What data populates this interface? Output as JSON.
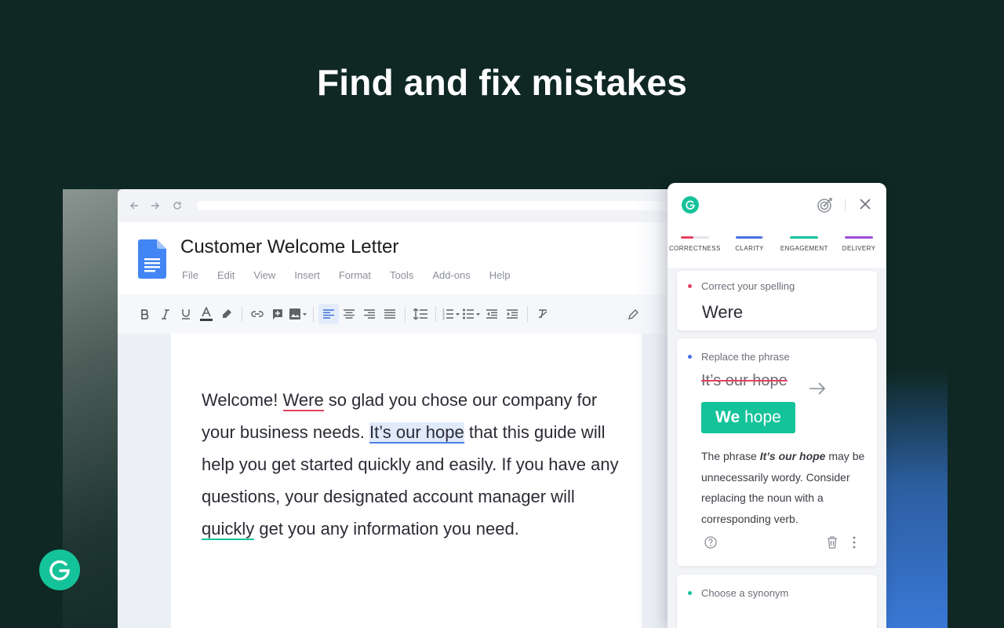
{
  "headline": "Find and fix mistakes",
  "document": {
    "title": "Customer Welcome Letter",
    "menu": [
      "File",
      "Edit",
      "View",
      "Insert",
      "Format",
      "Tools",
      "Add-ons",
      "Help"
    ],
    "text": {
      "p1": "Welcome! ",
      "flag_spelling": "Were",
      "p2": " so glad you chose our company for your business needs. ",
      "flag_phrase": "It’s our hope",
      "p3": " that this guide will help you get started quickly and easily. If you have any questions, your designated account manager will ",
      "flag_synonym": "quickly",
      "p4": " get you any information you need."
    },
    "toolbar_icons": [
      "bold-icon",
      "italic-icon",
      "underline-icon",
      "text-color-icon",
      "highlight-icon",
      "link-icon",
      "comment-icon",
      "image-icon",
      "align-left-icon",
      "align-center-icon",
      "align-right-icon",
      "justify-icon",
      "line-spacing-icon",
      "numbered-list-icon",
      "bulleted-list-icon",
      "decrease-indent-icon",
      "increase-indent-icon",
      "clear-formatting-icon",
      "edit-mode-icon"
    ]
  },
  "panel": {
    "categories": [
      {
        "label": "CORRECTNESS",
        "color": "#e5415f",
        "fill": 0.45
      },
      {
        "label": "CLARITY",
        "color": "#4a6ee0",
        "fill": 0.95
      },
      {
        "label": "ENGAGEMENT",
        "color": "#15c39a",
        "fill": 1.0
      },
      {
        "label": "DELIVERY",
        "color": "#9b4ed8",
        "fill": 1.0
      }
    ],
    "cards": [
      {
        "heading": "Correct your spelling",
        "dot_color": "#e5415f",
        "suggestion": "Were"
      },
      {
        "heading": "Replace the phrase",
        "dot_color": "#4a6ee0",
        "original": "It’s our hope",
        "replacement_bold": "We",
        "replacement_rest": "hope",
        "explanation_prefix": "The phrase ",
        "explanation_emph": "It’s our hope",
        "explanation_suffix": " may be unnecessarily wordy. Consider replacing the noun with a corresponding verb."
      },
      {
        "heading": "Choose a synonym",
        "dot_color": "#15c39a"
      }
    ]
  },
  "colors": {
    "brand_green": "#15c39a",
    "background": "#0f2824",
    "spelling_red": "#e5415f",
    "clarity_blue": "#4a7ee8"
  }
}
